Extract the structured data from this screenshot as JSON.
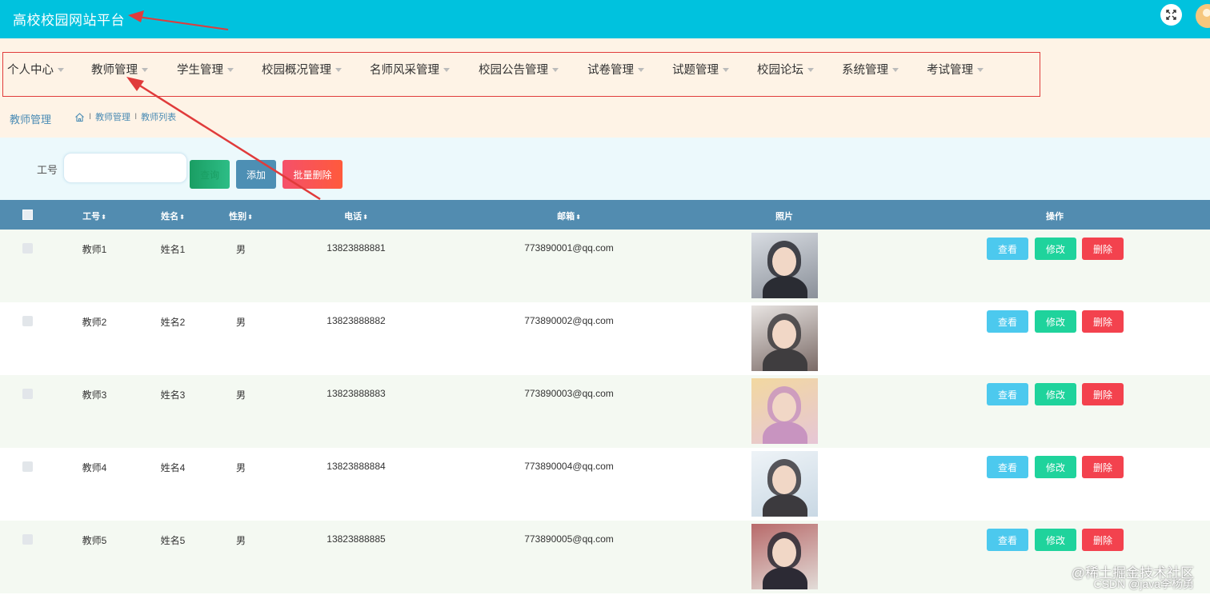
{
  "header": {
    "title": "高校校园网站平台",
    "fullscreen_icon": "fullscreen-icon",
    "avatar_icon": "user-avatar-icon"
  },
  "colors": {
    "header_bg": "#00c2de",
    "menubar_bg": "#fef3e6",
    "table_header_bg": "#528cb0",
    "view_btn": "#4cc9ee",
    "edit_btn": "#1fd39c",
    "delete_btn": "#f3424e",
    "annotation": "#e03b3b"
  },
  "menu": [
    {
      "label": "个人中心"
    },
    {
      "label": "教师管理"
    },
    {
      "label": "学生管理"
    },
    {
      "label": "校园概况管理"
    },
    {
      "label": "名师风采管理"
    },
    {
      "label": "校园公告管理"
    },
    {
      "label": "试卷管理"
    },
    {
      "label": "试题管理"
    },
    {
      "label": "校园论坛"
    },
    {
      "label": "系统管理"
    },
    {
      "label": "考试管理"
    }
  ],
  "breadcrumb": {
    "title": "教师管理",
    "home_icon": "home-icon",
    "items": [
      "教师管理",
      "教师列表"
    ]
  },
  "search": {
    "label": "工号",
    "value": "",
    "query_label": "查询",
    "add_label": "添加",
    "batch_delete_label": "批量删除"
  },
  "table": {
    "headers": {
      "gonghao": "工号",
      "name": "姓名",
      "gender": "性别",
      "phone": "电话",
      "email": "邮箱",
      "photo": "照片",
      "actions": "操作"
    },
    "sort_icon": "sort-icon",
    "rows": [
      {
        "gonghao": "教师1",
        "name": "姓名1",
        "gender": "男",
        "phone": "13823888881",
        "email": "773890001@qq.com"
      },
      {
        "gonghao": "教师2",
        "name": "姓名2",
        "gender": "男",
        "phone": "13823888882",
        "email": "773890002@qq.com"
      },
      {
        "gonghao": "教师3",
        "name": "姓名3",
        "gender": "男",
        "phone": "13823888883",
        "email": "773890003@qq.com"
      },
      {
        "gonghao": "教师4",
        "name": "姓名4",
        "gender": "男",
        "phone": "13823888884",
        "email": "773890004@qq.com"
      },
      {
        "gonghao": "教师5",
        "name": "姓名5",
        "gender": "男",
        "phone": "13823888885",
        "email": "773890005@qq.com"
      }
    ],
    "actions": {
      "view": "查看",
      "edit": "修改",
      "delete": "删除"
    }
  },
  "watermark": {
    "line1": "@稀土掘金技术社区",
    "line2": "CSDN @java李杨勇"
  }
}
